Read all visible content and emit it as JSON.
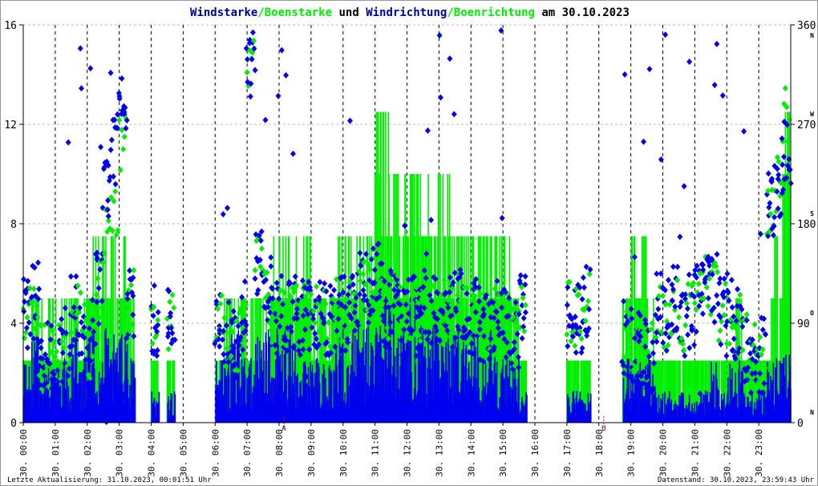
{
  "title": {
    "part1": "Windstarke",
    "sep1": "/",
    "part2": "Boenstarke",
    "part3": " und ",
    "part4": "Windrichtung",
    "sep2": "/",
    "part5": "Boenrichtung",
    "part6": " am 30.10.2023"
  },
  "colors": {
    "wind": "#0000ee",
    "gust": "#00ee00",
    "title_blue": "#000099",
    "marker": "#ff0000"
  },
  "footer": {
    "left": "Letzte Aktualisierung: 31.10.2023, 00:01:51 Uhr",
    "right": "Datenstand: 30.10.2023, 23:59:43 Uhr"
  },
  "chart_data": {
    "type": "bar",
    "title": "Windstarke/Boenstarke und Windrichtung/Boenrichtung am 30.10.2023",
    "x_tick_labels": [
      "30. 00:00",
      "30. 01:00",
      "30. 02:00",
      "30. 03:00",
      "30. 04:00",
      "30. 05:00",
      "30. 06:00",
      "30. 07:00",
      "30. 08:00",
      "30. 09:00",
      "30. 10:00",
      "30. 11:00",
      "30. 12:00",
      "30. 13:00",
      "30. 14:00",
      "30. 15:00",
      "30. 16:00",
      "30. 17:00",
      "30. 18:00",
      "30. 19:00",
      "30. 20:00",
      "30. 21:00",
      "30. 22:00",
      "30. 23:00"
    ],
    "y_left": {
      "ticks": [
        "0",
        "4",
        "8",
        "12",
        "16"
      ],
      "ylim": [
        0,
        16
      ]
    },
    "y_right": {
      "ticks": [
        "0",
        "90",
        "180",
        "270",
        "360"
      ],
      "ylim": [
        0,
        360
      ],
      "compass": [
        "N",
        "O",
        "S",
        "W",
        "N"
      ]
    },
    "grid": true,
    "markers": [
      {
        "label": "A",
        "hour": 8.15
      },
      {
        "label": "U",
        "hour": 18.15
      }
    ],
    "interval_minutes": 15,
    "series": [
      {
        "name": "Windstarke",
        "values": [
          2,
          3,
          2,
          2,
          2,
          2,
          3,
          2,
          3,
          2,
          3,
          3,
          3,
          2,
          null,
          null,
          1,
          null,
          1,
          null,
          null,
          null,
          null,
          null,
          2,
          2,
          3,
          2,
          2,
          3,
          3,
          3,
          3,
          3,
          2,
          2,
          2,
          2,
          2,
          3,
          2,
          3,
          3,
          3,
          3,
          4,
          4,
          3,
          4,
          3,
          3,
          3,
          3,
          3,
          3,
          3,
          3,
          2,
          3,
          2,
          2,
          2,
          1,
          null,
          null,
          null,
          null,
          null,
          1,
          1,
          1,
          null,
          null,
          null,
          null,
          2,
          2,
          2,
          2,
          1,
          1,
          1,
          1,
          1,
          1,
          1,
          2,
          1,
          2,
          2,
          1,
          1,
          1,
          2,
          2,
          3
        ]
      },
      {
        "name": "Boenstarke",
        "values": [
          3,
          5,
          4,
          4,
          4,
          5,
          5,
          4,
          6,
          7.5,
          7.5,
          7.5,
          7.5,
          5,
          null,
          null,
          2.5,
          null,
          2.5,
          null,
          null,
          null,
          null,
          null,
          2.5,
          5,
          5,
          5,
          5,
          5,
          6,
          7.5,
          8,
          7.5,
          7.5,
          7.5,
          5,
          5,
          5,
          7.5,
          7.5,
          7.5,
          7.5,
          7.5,
          13,
          13,
          10,
          10,
          10,
          10,
          10,
          10,
          10,
          10,
          7.5,
          7.5,
          7.5,
          7.5,
          7.5,
          7.5,
          7.5,
          5,
          2.5,
          null,
          null,
          null,
          null,
          null,
          2.5,
          2.5,
          2.5,
          null,
          null,
          null,
          null,
          5,
          7.5,
          7.5,
          5,
          2.5,
          2.5,
          2.5,
          2.5,
          2.5,
          2.5,
          2.5,
          2.5,
          2.5,
          2.5,
          5,
          2.5,
          2.5,
          2.5,
          5,
          7.5,
          13
        ]
      },
      {
        "name": "Windrichtung",
        "values": [
          95,
          110,
          60,
          60,
          60,
          70,
          100,
          90,
          60,
          120,
          220,
          250,
          300,
          110,
          null,
          null,
          95,
          null,
          90,
          null,
          null,
          null,
          null,
          null,
          90,
          80,
          75,
          95,
          330,
          150,
          120,
          95,
          100,
          95,
          95,
          100,
          100,
          100,
          90,
          100,
          100,
          115,
          120,
          125,
          130,
          100,
          110,
          95,
          100,
          95,
          110,
          105,
          100,
          100,
          110,
          95,
          95,
          90,
          90,
          95,
          90,
          80,
          100,
          null,
          null,
          null,
          null,
          null,
          100,
          95,
          110,
          null,
          null,
          null,
          null,
          75,
          70,
          65,
          60,
          100,
          95,
          110,
          90,
          100,
          115,
          130,
          120,
          100,
          95,
          90,
          70,
          60,
          60,
          200,
          220,
          240
        ]
      },
      {
        "name": "Boenrichtung",
        "values": [
          95,
          110,
          60,
          60,
          60,
          70,
          100,
          90,
          60,
          120,
          170,
          200,
          250,
          110,
          null,
          null,
          95,
          null,
          90,
          null,
          null,
          null,
          null,
          null,
          90,
          80,
          75,
          95,
          330,
          150,
          120,
          95,
          100,
          95,
          95,
          100,
          100,
          100,
          90,
          100,
          100,
          115,
          120,
          125,
          130,
          100,
          110,
          95,
          100,
          95,
          110,
          105,
          100,
          100,
          110,
          95,
          95,
          90,
          90,
          95,
          90,
          80,
          100,
          null,
          null,
          null,
          null,
          null,
          100,
          95,
          110,
          null,
          null,
          null,
          null,
          75,
          70,
          65,
          60,
          100,
          95,
          110,
          90,
          100,
          115,
          130,
          120,
          100,
          95,
          90,
          70,
          60,
          60,
          200,
          220,
          280
        ]
      }
    ]
  }
}
